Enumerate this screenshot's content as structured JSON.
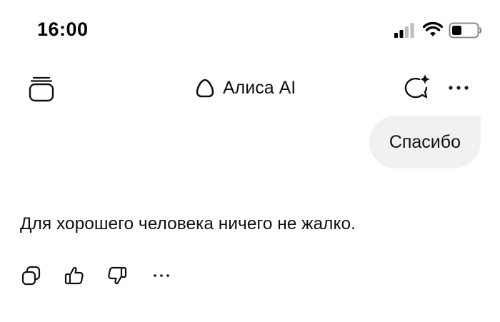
{
  "status_bar": {
    "time": "16:00",
    "icons": [
      "signal-icon",
      "wifi-icon",
      "battery-icon"
    ]
  },
  "header": {
    "title": "Алиса AI",
    "icons": {
      "left": "chats-stack-icon",
      "logo": "alice-logo-icon",
      "new_chat": "new-chat-sparkle-icon",
      "more": "more-dots-icon"
    }
  },
  "chat": {
    "user_message": "Спасибо",
    "assistant_message": "Для хорошего человека ничего не жалко.",
    "actions": [
      "copy-icon",
      "thumbs-up-icon",
      "thumbs-down-icon",
      "more-dots-icon"
    ]
  },
  "colors": {
    "bubble_bg": "#f1f1f1",
    "text": "#111111"
  }
}
